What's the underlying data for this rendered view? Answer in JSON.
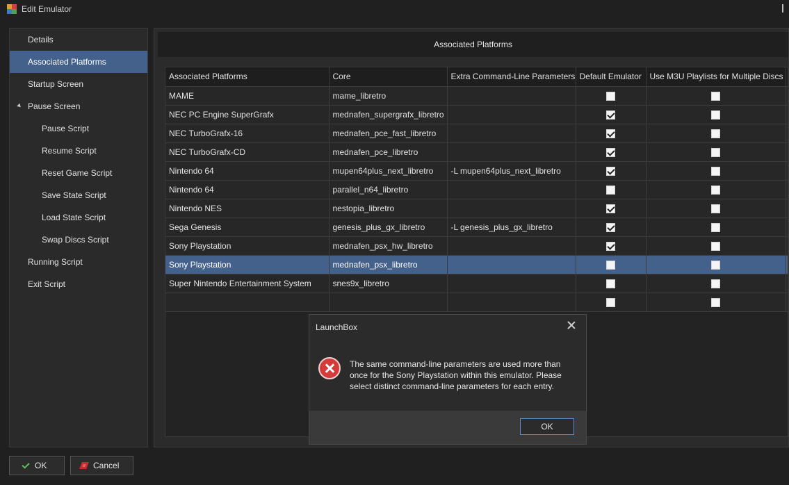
{
  "window": {
    "title": "Edit Emulator"
  },
  "sidebar": {
    "items": [
      {
        "label": "Details"
      },
      {
        "label": "Associated Platforms"
      },
      {
        "label": "Startup Screen"
      },
      {
        "label": "Pause Screen"
      },
      {
        "label": "Pause Script"
      },
      {
        "label": "Resume Script"
      },
      {
        "label": "Reset Game Script"
      },
      {
        "label": "Save State Script"
      },
      {
        "label": "Load State Script"
      },
      {
        "label": "Swap Discs Script"
      },
      {
        "label": "Running Script"
      },
      {
        "label": "Exit Script"
      }
    ]
  },
  "main": {
    "header": "Associated Platforms",
    "columns": [
      "Associated Platforms",
      "Core",
      "Extra Command-Line Parameters",
      "Default Emulator",
      "Use M3U Playlists for Multiple Discs",
      ""
    ],
    "rows": [
      {
        "platform": "MAME",
        "core": "mame_libretro",
        "params": "",
        "default": false,
        "m3u": false
      },
      {
        "platform": "NEC PC Engine SuperGrafx",
        "core": "mednafen_supergrafx_libretro",
        "params": "",
        "default": true,
        "m3u": false
      },
      {
        "platform": "NEC TurboGrafx-16",
        "core": "mednafen_pce_fast_libretro",
        "params": "",
        "default": true,
        "m3u": false
      },
      {
        "platform": "NEC TurboGrafx-CD",
        "core": "mednafen_pce_libretro",
        "params": "",
        "default": true,
        "m3u": false
      },
      {
        "platform": "Nintendo 64",
        "core": "mupen64plus_next_libretro",
        "params": "-L mupen64plus_next_libretro",
        "default": true,
        "m3u": false
      },
      {
        "platform": "Nintendo 64",
        "core": "parallel_n64_libretro",
        "params": "",
        "default": false,
        "m3u": false
      },
      {
        "platform": "Nintendo NES",
        "core": "nestopia_libretro",
        "params": "",
        "default": true,
        "m3u": false
      },
      {
        "platform": "Sega Genesis",
        "core": "genesis_plus_gx_libretro",
        "params": "-L genesis_plus_gx_libretro",
        "default": true,
        "m3u": false
      },
      {
        "platform": "Sony Playstation",
        "core": "mednafen_psx_hw_libretro",
        "params": "",
        "default": true,
        "m3u": false
      },
      {
        "platform": "Sony Playstation",
        "core": "mednafen_psx_libretro",
        "params": "",
        "default": false,
        "m3u": false
      },
      {
        "platform": "Super Nintendo Entertainment System",
        "core": "snes9x_libretro",
        "params": "",
        "default": false,
        "m3u": false
      },
      {
        "platform": "",
        "core": "",
        "params": "",
        "default": false,
        "m3u": false
      }
    ]
  },
  "buttons": {
    "ok": "OK",
    "cancel": "Cancel"
  },
  "dialog": {
    "title": "LaunchBox",
    "message": "The same command-line parameters are used more than once for the Sony Playstation within this emulator. Please select distinct command-line parameters for each entry.",
    "ok": "OK"
  }
}
